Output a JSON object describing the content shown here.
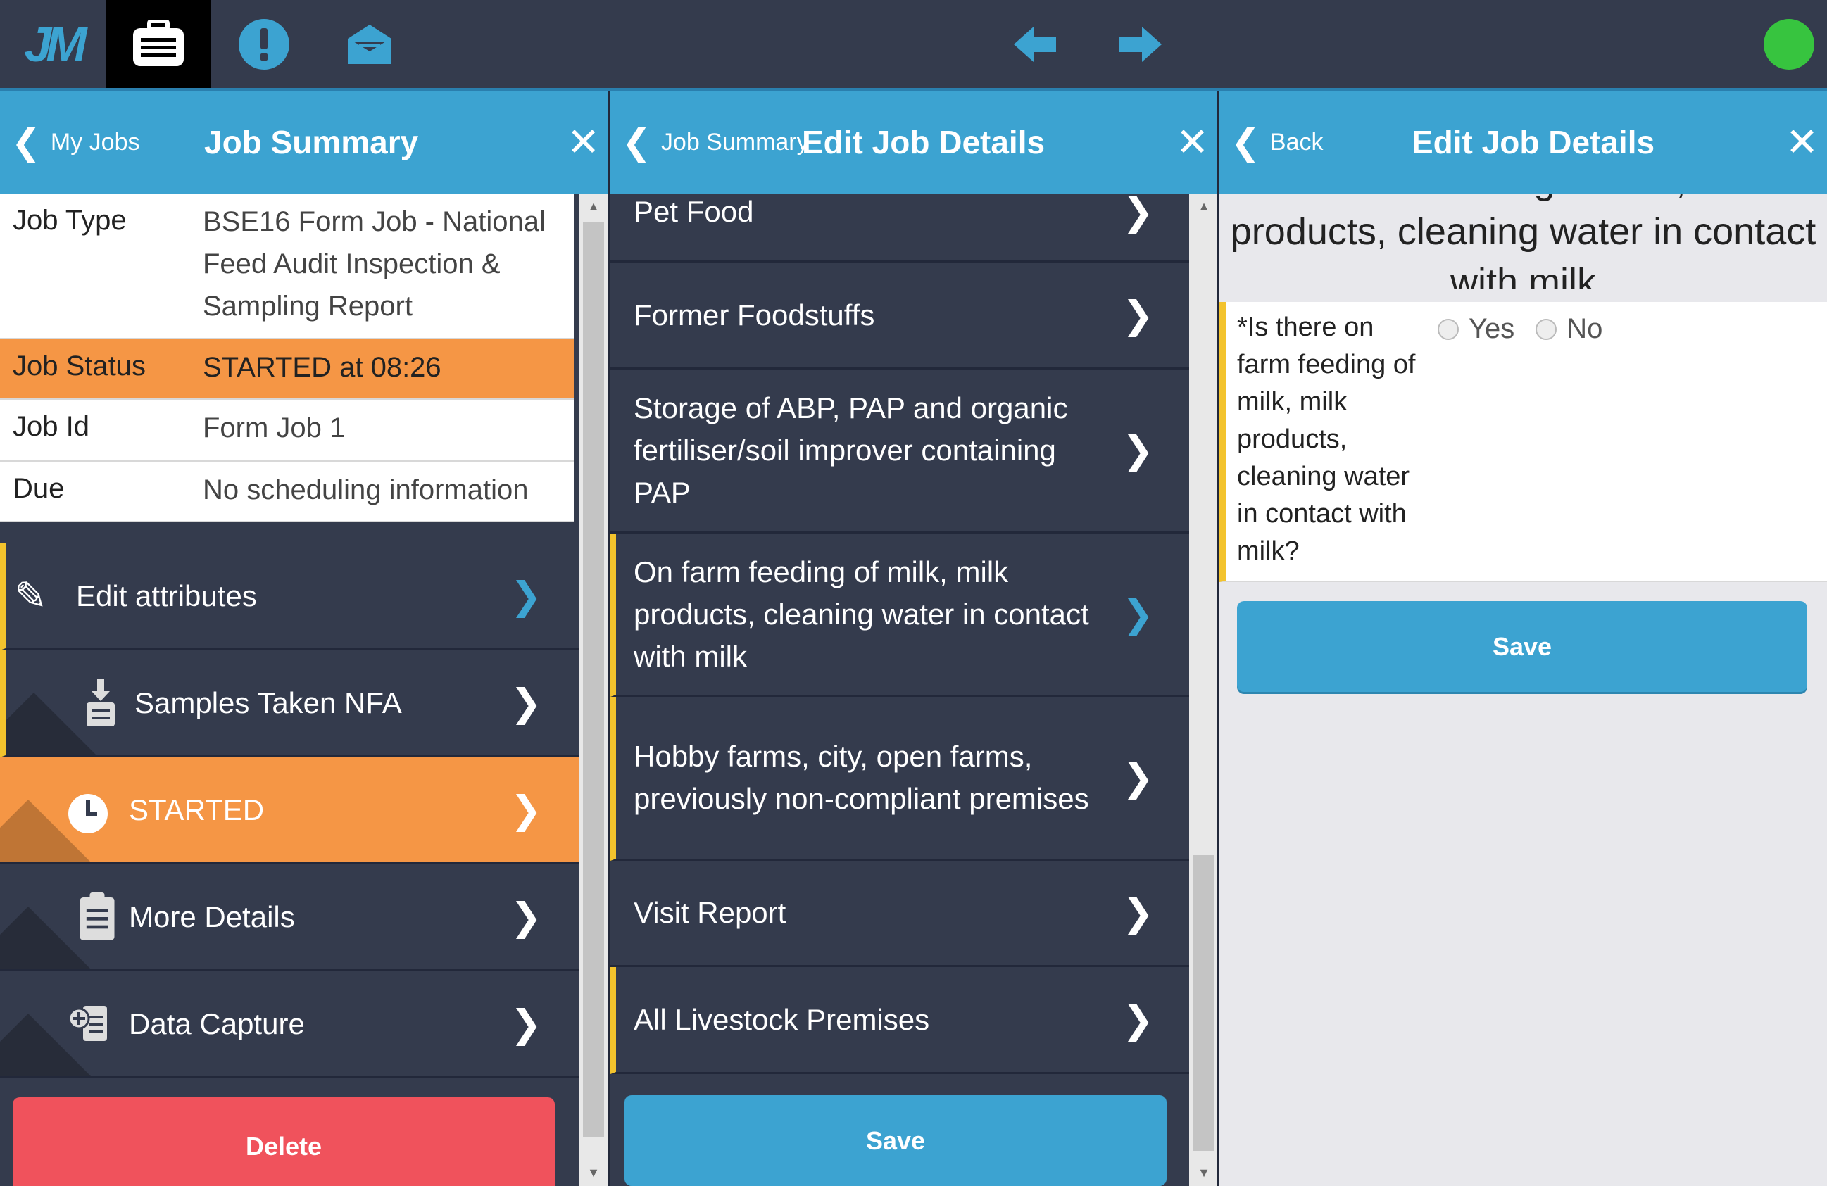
{
  "topbar": {
    "logo_text": "JM",
    "icons": [
      "jobs-icon",
      "alert-icon",
      "message-icon",
      "arrow-left-icon",
      "arrow-right-icon"
    ],
    "status_color": "#37c43f"
  },
  "panel1": {
    "back_label": "My Jobs",
    "title": "Job Summary",
    "summary": [
      {
        "label": "Job Type",
        "value": "BSE16 Form Job - National Feed Audit Inspection & Sampling Report"
      },
      {
        "label": "Job Status",
        "value": "STARTED at 08:26"
      },
      {
        "label": "Job Id",
        "value": "Form Job 1"
      },
      {
        "label": "Due",
        "value": "No scheduling information"
      }
    ],
    "menu": [
      {
        "label": "Edit attributes",
        "icon": "pencil-icon"
      },
      {
        "label": "Samples Taken NFA",
        "icon": "clipboard-download-icon"
      },
      {
        "label": "STARTED",
        "icon": "clock-icon"
      },
      {
        "label": "More Details",
        "icon": "clipboard-icon"
      },
      {
        "label": "Data Capture",
        "icon": "clipboard-add-icon"
      }
    ],
    "delete_label": "Delete"
  },
  "panel2": {
    "back_label": "Job Summary",
    "title": "Edit Job Details",
    "items": [
      "Pet Food",
      "Former Foodstuffs",
      "Storage of ABP, PAP and organic fertiliser/soil improver containing PAP",
      "On farm feeding of milk, milk products, cleaning water in contact with milk",
      "Hobby farms, city, open farms, previously non-compliant premises",
      "Visit Report",
      "All Livestock Premises"
    ],
    "save_label": "Save"
  },
  "panel3": {
    "back_label": "Back",
    "title": "Edit Job Details",
    "heading": "On farm feeding of milk, milk products, cleaning water in contact with milk",
    "question": "*Is there on farm feeding of milk, milk products, cleaning water in contact with milk?",
    "options": [
      "Yes",
      "No"
    ],
    "save_label": "Save"
  },
  "colors": {
    "header_blue": "#3ca3d1",
    "dark_bg": "#343b4d",
    "orange": "#f59645",
    "yellow_marker": "#f3c32d",
    "delete_red": "#f0525c"
  }
}
